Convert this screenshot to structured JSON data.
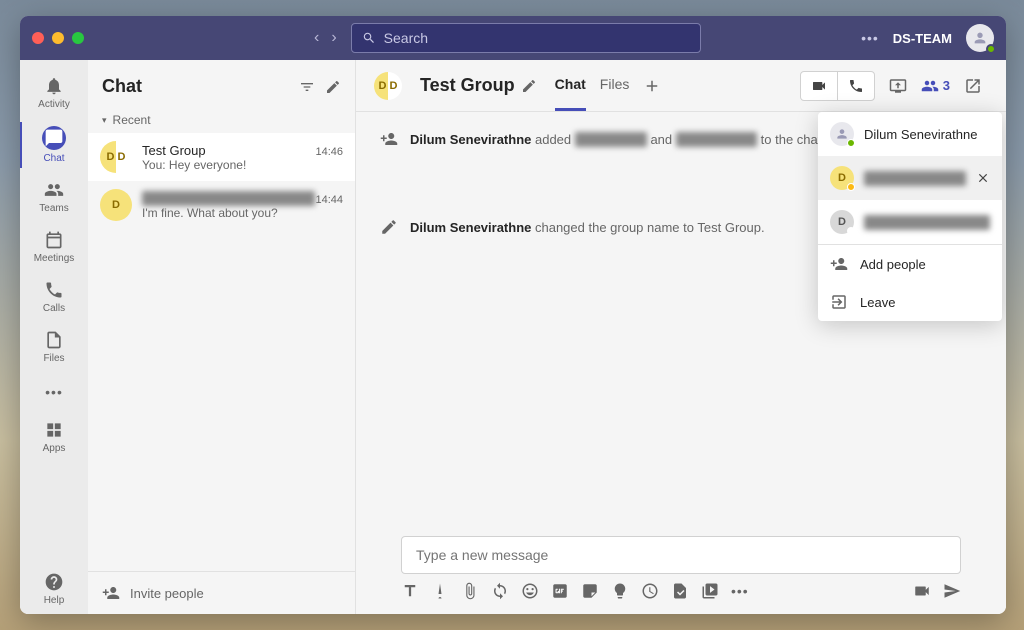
{
  "titlebar": {
    "search_placeholder": "Search",
    "org": "DS-TEAM"
  },
  "rail": {
    "items": [
      {
        "label": "Activity"
      },
      {
        "label": "Chat"
      },
      {
        "label": "Teams"
      },
      {
        "label": "Meetings"
      },
      {
        "label": "Calls"
      },
      {
        "label": "Files"
      },
      {
        "label": "Apps"
      },
      {
        "label": "Help"
      }
    ]
  },
  "chatlist": {
    "title": "Chat",
    "section": "Recent",
    "items": [
      {
        "name": "Test Group",
        "time": "14:46",
        "preview": "You: Hey everyone!",
        "initials": "D D"
      },
      {
        "name": "████████",
        "time": "14:44",
        "preview": "I'm fine. What about you?",
        "initials": "D"
      }
    ],
    "invite": "Invite people"
  },
  "main": {
    "title": "Test Group",
    "avatar_initials": "D D",
    "tabs": {
      "chat": "Chat",
      "files": "Files"
    },
    "participants": "3",
    "sys1_author": "Dilum Senevirathne",
    "sys1_mid": " added ",
    "sys1_r1": "███ ████",
    "sys1_and": " and ",
    "sys1_r2": "███ █████",
    "sys1_tail": " to the chat.",
    "sys2_author": "Dilum Senevirathne",
    "sys2_tail": " changed the group name to ",
    "sys2_group": "Test Group.",
    "compose_placeholder": "Type a new message"
  },
  "popup": {
    "p1": "Dilum Senevirathne",
    "p2": "████████",
    "p3": "████████",
    "add": "Add people",
    "leave": "Leave"
  }
}
